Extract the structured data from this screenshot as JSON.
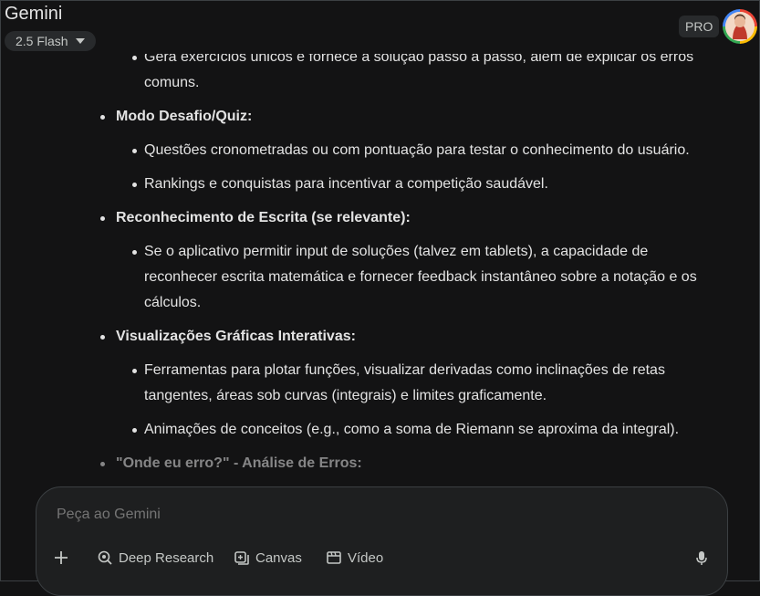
{
  "header": {
    "app_title": "Gemini",
    "model": "2.5 Flash",
    "badge": "PRO"
  },
  "content": {
    "partial_line_top": "Gera exercícios únicos e fornece a solução passo a passo, além de explicar os erros",
    "partial_line_top_cont": "comuns.",
    "sections": [
      {
        "title": "Modo Desafio/Quiz:",
        "items": [
          "Questões cronometradas ou com pontuação para testar o conhecimento do usuário.",
          "Rankings e conquistas para incentivar a competição saudável."
        ]
      },
      {
        "title": "Reconhecimento de Escrita (se relevante):",
        "items": [
          "Se o aplicativo permitir input de soluções (talvez em tablets), a capacidade de",
          "reconhecer escrita matemática e fornecer feedback instantâneo sobre a notação e os",
          "cálculos."
        ]
      },
      {
        "title": "Visualizações Gráficas Interativas:",
        "items": [
          "Ferramentas para plotar funções, visualizar derivadas como inclinações de retas",
          "tangentes, áreas sob curvas (integrais) e limites graficamente.",
          "Animações de conceitos (e.g., como a soma de Riemann se aproxima da integral)."
        ]
      },
      {
        "title": "\"Onde eu erro?\" - Análise de Erros:"
      }
    ]
  },
  "composer": {
    "placeholder": "Peça ao Gemini",
    "tools": {
      "deep_research": "Deep Research",
      "canvas": "Canvas",
      "video": "Vídeo"
    }
  }
}
